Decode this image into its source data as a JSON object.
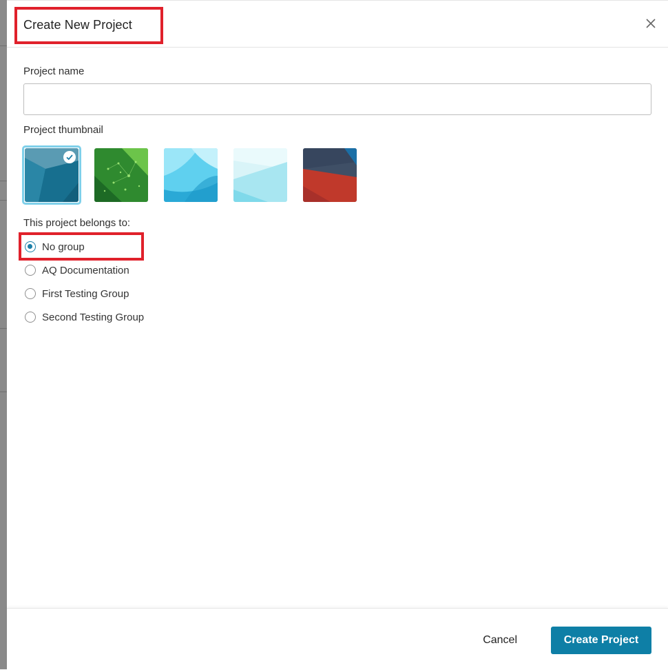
{
  "dialog": {
    "title": "Create New Project",
    "close_icon": "close-icon"
  },
  "form": {
    "name_label": "Project name",
    "name_value": "",
    "name_placeholder": "",
    "thumbnail_label": "Project thumbnail",
    "thumbnails": [
      {
        "name": "thumbnail-teal-polygon",
        "selected": true
      },
      {
        "name": "thumbnail-green-circuit",
        "selected": false
      },
      {
        "name": "thumbnail-light-blue-waves",
        "selected": false
      },
      {
        "name": "thumbnail-pale-cyan",
        "selected": false
      },
      {
        "name": "thumbnail-red-slate",
        "selected": false
      }
    ],
    "check_icon": "check-icon",
    "group_label": "This project belongs to:",
    "groups": [
      {
        "label": "No group",
        "checked": true
      },
      {
        "label": "AQ Documentation",
        "checked": false
      },
      {
        "label": "First Testing Group",
        "checked": false
      },
      {
        "label": "Second Testing Group",
        "checked": false
      }
    ]
  },
  "footer": {
    "cancel_label": "Cancel",
    "create_label": "Create Project"
  },
  "colors": {
    "accent": "#0e7fa6",
    "highlight": "#e0212b",
    "selected_ring": "#7fd0ea"
  }
}
